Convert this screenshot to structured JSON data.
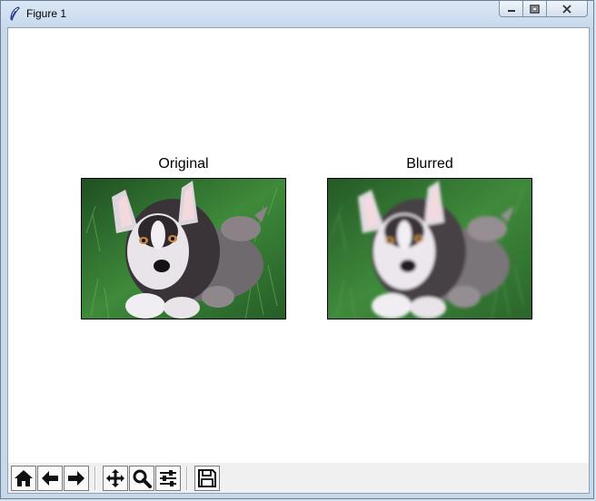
{
  "window": {
    "title": "Figure 1"
  },
  "figure": {
    "subplots": [
      {
        "title": "Original",
        "image": "husky-puppy-photo"
      },
      {
        "title": "Blurred",
        "image": "husky-puppy-photo-blurred"
      }
    ]
  },
  "toolbar": {
    "buttons": [
      {
        "name": "home",
        "icon": "home-icon"
      },
      {
        "name": "back",
        "icon": "arrow-left-icon"
      },
      {
        "name": "forward",
        "icon": "arrow-right-icon"
      },
      {
        "name": "pan",
        "icon": "move-icon"
      },
      {
        "name": "zoom",
        "icon": "magnifier-icon"
      },
      {
        "name": "configure-subplots",
        "icon": "sliders-icon"
      },
      {
        "name": "save",
        "icon": "floppy-disk-icon"
      }
    ]
  },
  "colors": {
    "grass": "#2e6b2c",
    "toolbar_bg": "#f0f0f0",
    "titlebar": "#c9daee"
  }
}
